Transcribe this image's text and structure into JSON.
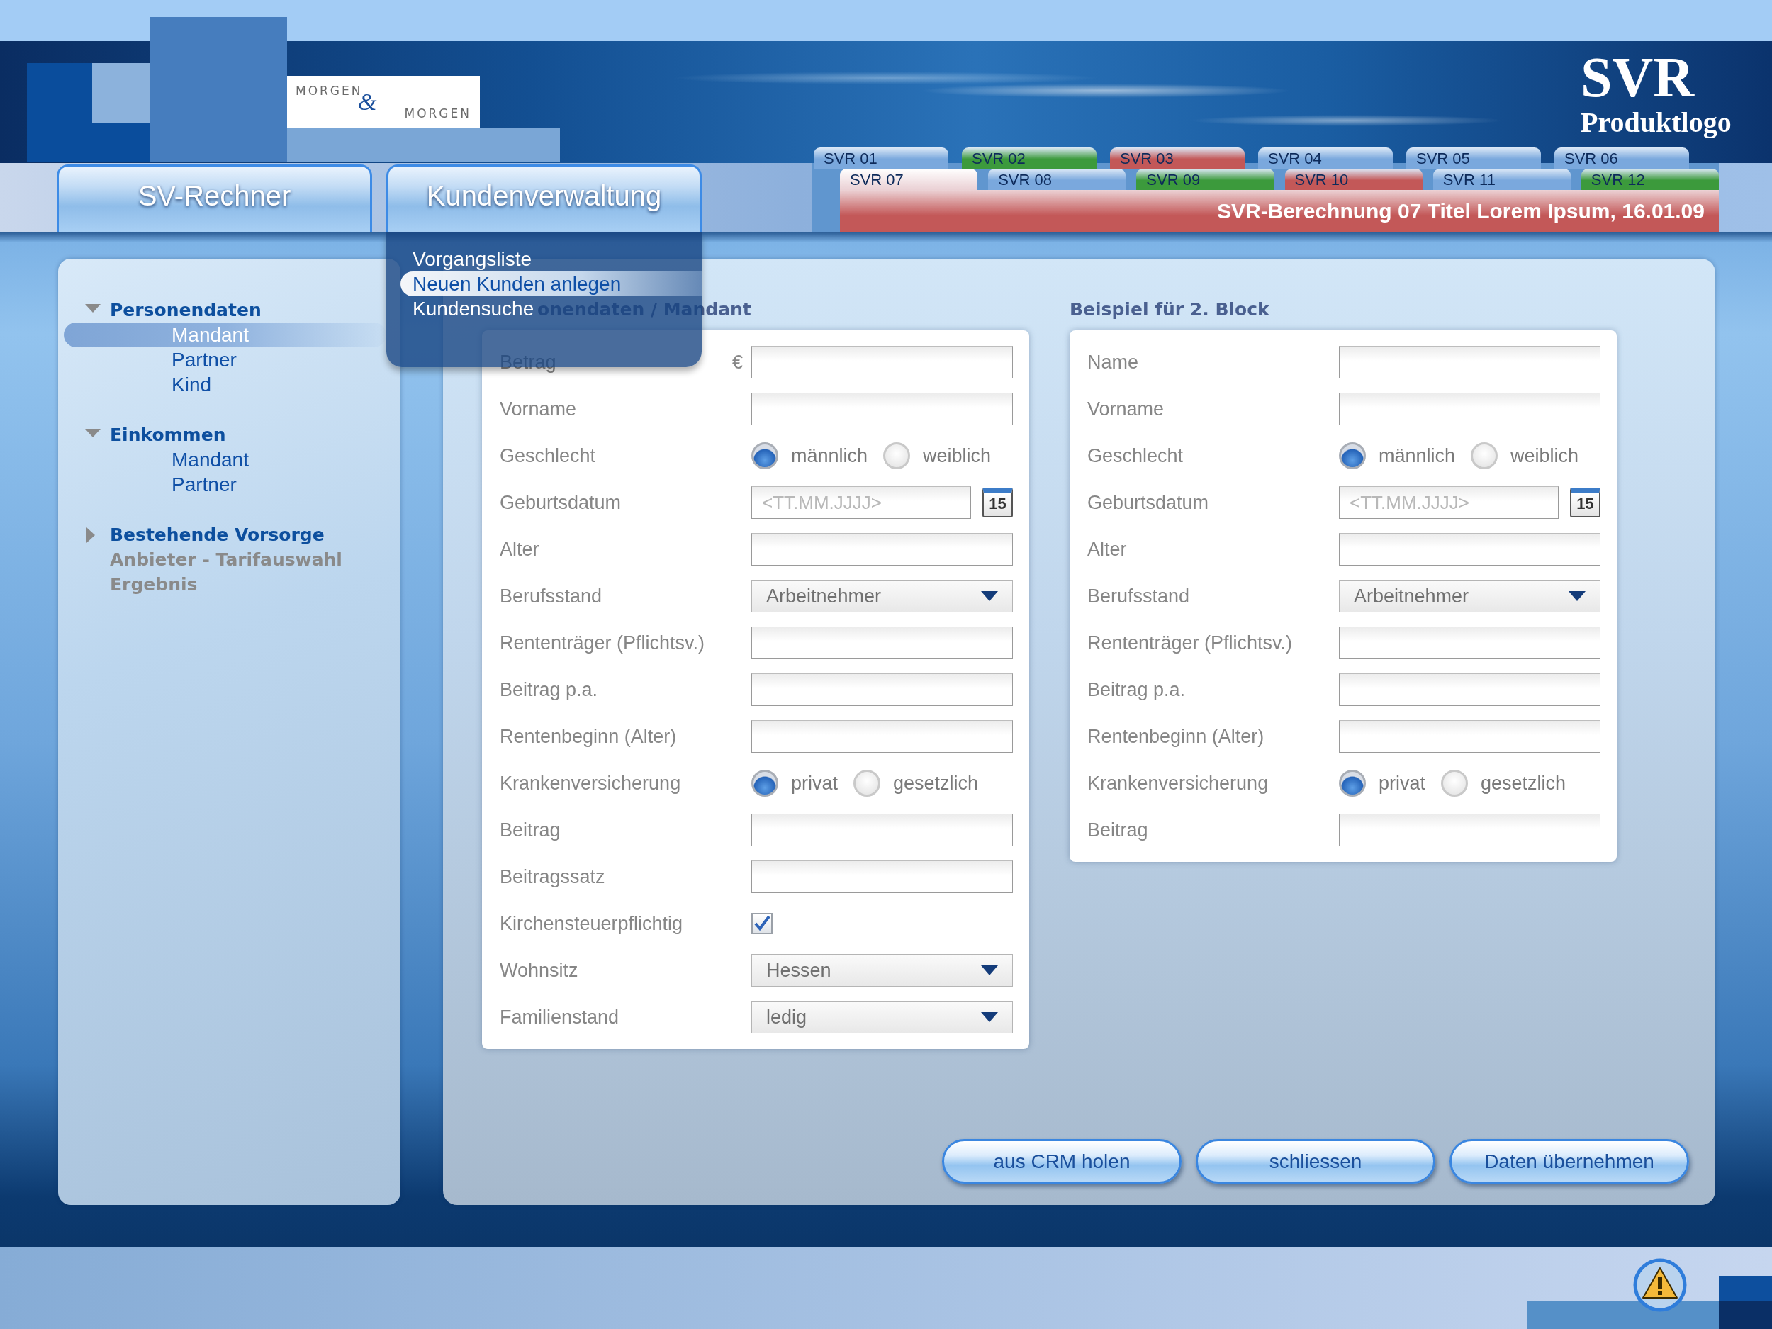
{
  "brand_logo": [
    "MORGEN",
    "&",
    "MORGEN"
  ],
  "product_logo": {
    "title": "SVR",
    "subtitle": "Produktlogo"
  },
  "nav": [
    {
      "label": "SV-Rechner"
    },
    {
      "label": "Kundenverwaltung",
      "menu": [
        {
          "label": "Vorgangsliste",
          "selected": false
        },
        {
          "label": "Neuen Kunden anlegen",
          "selected": true
        },
        {
          "label": "Kundensuche",
          "selected": false
        }
      ]
    }
  ],
  "tab_strip": {
    "rows": [
      [
        {
          "label": "SVR 01",
          "color": "#7aa8dd",
          "selected": false
        },
        {
          "label": "SVR 02",
          "color": "#3c9a3c",
          "selected": false
        },
        {
          "label": "SVR 03",
          "color": "#c35858",
          "selected": false
        },
        {
          "label": "SVR 04",
          "color": "#7aa8dd",
          "selected": false
        },
        {
          "label": "SVR 05",
          "color": "#7aa8dd",
          "selected": false
        },
        {
          "label": "SVR 06",
          "color": "#7aa8dd",
          "selected": false
        }
      ],
      [
        {
          "label": "SVR 07",
          "color": "#c35858",
          "selected": true
        },
        {
          "label": "SVR 08",
          "color": "#7aa8dd",
          "selected": false
        },
        {
          "label": "SVR 09",
          "color": "#3c9a3c",
          "selected": false
        },
        {
          "label": "SVR 10",
          "color": "#c35858",
          "selected": false
        },
        {
          "label": "SVR 11",
          "color": "#7aa8dd",
          "selected": false
        },
        {
          "label": "SVR 12",
          "color": "#3c9a3c",
          "selected": false
        }
      ]
    ],
    "title": "SVR-Berechnung 07 Titel Lorem Ipsum, 16.01.09"
  },
  "sidebar": {
    "items": [
      {
        "label": "Personendaten",
        "kind": "group",
        "expanded": true,
        "disabled": false,
        "children": [
          {
            "label": "Mandant",
            "selected": true
          },
          {
            "label": "Partner",
            "selected": false
          },
          {
            "label": "Kind",
            "selected": false
          }
        ]
      },
      {
        "label": "Einkommen",
        "kind": "group",
        "expanded": true,
        "disabled": false,
        "children": [
          {
            "label": "Mandant",
            "selected": false
          },
          {
            "label": "Partner",
            "selected": false
          }
        ]
      },
      {
        "label": "Bestehende Vorsorge",
        "kind": "group",
        "expanded": false,
        "disabled": false
      },
      {
        "label": "Anbieter - Tarifauswahl",
        "kind": "step",
        "disabled": true
      },
      {
        "label": "Ergebnis",
        "kind": "step",
        "disabled": true
      }
    ]
  },
  "blocks": [
    {
      "title": "onendaten / Mandant",
      "rows": [
        {
          "label": "Betrag",
          "kind": "text",
          "unit": "€"
        },
        {
          "label": "Vorname",
          "kind": "text"
        },
        {
          "label": "Geschlecht",
          "kind": "radio",
          "options": [
            {
              "label": "männlich",
              "selected": true
            },
            {
              "label": "weiblich",
              "selected": false
            }
          ]
        },
        {
          "label": "Geburtsdatum",
          "kind": "date",
          "placeholder": "<TT.MM.JJJJ>",
          "calendar_day": "15"
        },
        {
          "label": "Alter",
          "kind": "text"
        },
        {
          "label": "Berufsstand",
          "kind": "select",
          "value": "Arbeitnehmer"
        },
        {
          "label": "Rententräger (Pflichtsv.)",
          "kind": "text"
        },
        {
          "label": "Beitrag p.a.",
          "kind": "text"
        },
        {
          "label": "Rentenbeginn (Alter)",
          "kind": "text"
        },
        {
          "label": "Krankenversicherung",
          "kind": "radio",
          "options": [
            {
              "label": "privat",
              "selected": true
            },
            {
              "label": "gesetzlich",
              "selected": false
            }
          ]
        },
        {
          "label": "Beitrag",
          "kind": "text"
        },
        {
          "label": "Beitragssatz",
          "kind": "text"
        },
        {
          "label": "Kirchensteuerpflichtig",
          "kind": "checkbox",
          "checked": true
        },
        {
          "label": "Wohnsitz",
          "kind": "select",
          "value": "Hessen"
        },
        {
          "label": "Familienstand",
          "kind": "select",
          "value": "ledig"
        }
      ]
    },
    {
      "title": "Beispiel für 2. Block",
      "rows": [
        {
          "label": "Name",
          "kind": "text"
        },
        {
          "label": "Vorname",
          "kind": "text"
        },
        {
          "label": "Geschlecht",
          "kind": "radio",
          "options": [
            {
              "label": "männlich",
              "selected": true
            },
            {
              "label": "weiblich",
              "selected": false
            }
          ]
        },
        {
          "label": "Geburtsdatum",
          "kind": "date",
          "placeholder": "<TT.MM.JJJJ>",
          "calendar_day": "15"
        },
        {
          "label": "Alter",
          "kind": "text"
        },
        {
          "label": "Berufsstand",
          "kind": "select",
          "value": "Arbeitnehmer"
        },
        {
          "label": "Rententräger (Pflichtsv.)",
          "kind": "text"
        },
        {
          "label": "Beitrag p.a.",
          "kind": "text"
        },
        {
          "label": "Rentenbeginn (Alter)",
          "kind": "text"
        },
        {
          "label": "Krankenversicherung",
          "kind": "radio",
          "options": [
            {
              "label": "privat",
              "selected": true
            },
            {
              "label": "gesetzlich",
              "selected": false
            }
          ]
        },
        {
          "label": "Beitrag",
          "kind": "text"
        }
      ]
    }
  ],
  "buttons": [
    "aus CRM holen",
    "schliessen",
    "Daten übernehmen"
  ]
}
